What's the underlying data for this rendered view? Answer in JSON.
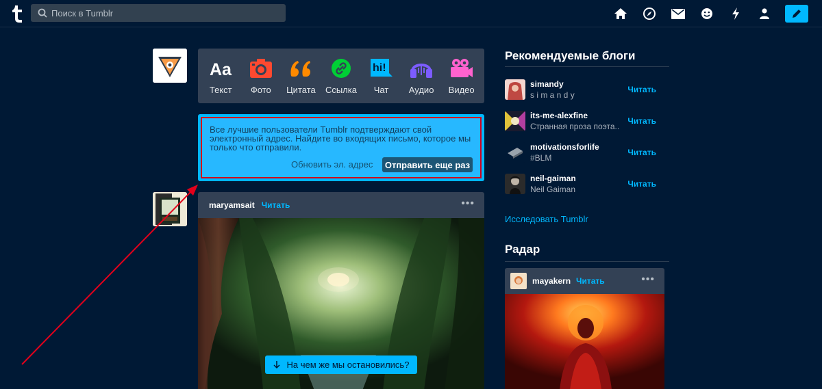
{
  "search": {
    "placeholder": "Поиск в Tumblr"
  },
  "nav": {
    "icons": [
      "home-icon",
      "explore-icon",
      "mail-icon",
      "emoji-icon",
      "lightning-icon",
      "user-icon",
      "compose-icon"
    ]
  },
  "post_types": [
    {
      "label": "Текст"
    },
    {
      "label": "Фото"
    },
    {
      "label": "Цитата"
    },
    {
      "label": "Ссылка"
    },
    {
      "label": "Чат",
      "icon_text": "hi!"
    },
    {
      "label": "Аудио"
    },
    {
      "label": "Видео"
    }
  ],
  "notice": {
    "text": "Все лучшие пользователи Tumblr подтверждают свой электронный адрес. Найдите во входящих письмо, которое мы только что отправили.",
    "update_label": "Обновить эл. адрес",
    "resend_label": "Отправить еще раз"
  },
  "post": {
    "username": "maryamsait",
    "follow_label": "Читать",
    "more": "•••"
  },
  "resume": {
    "label": "На чем же мы остановились?"
  },
  "sidebar": {
    "title": "Рекомендуемые блоги",
    "blogs": [
      {
        "name": "simandy",
        "subtitle": "s i m a n d y",
        "follow": "Читать"
      },
      {
        "name": "its-me-alexfine",
        "subtitle": "Странная проза поэта...",
        "follow": "Читать"
      },
      {
        "name": "motivationsforlife",
        "subtitle": "#BLM",
        "follow": "Читать"
      },
      {
        "name": "neil-gaiman",
        "subtitle": "Neil Gaiman",
        "follow": "Читать"
      }
    ],
    "explore_label": "Исследовать Tumblr",
    "radar_title": "Радар",
    "radar_post": {
      "username": "mayakern",
      "follow_label": "Читать",
      "more": "•••"
    }
  },
  "colors": {
    "background": "#001935",
    "accent": "#00b8ff",
    "panel": "#334155",
    "highlight_border": "#d4001b"
  }
}
